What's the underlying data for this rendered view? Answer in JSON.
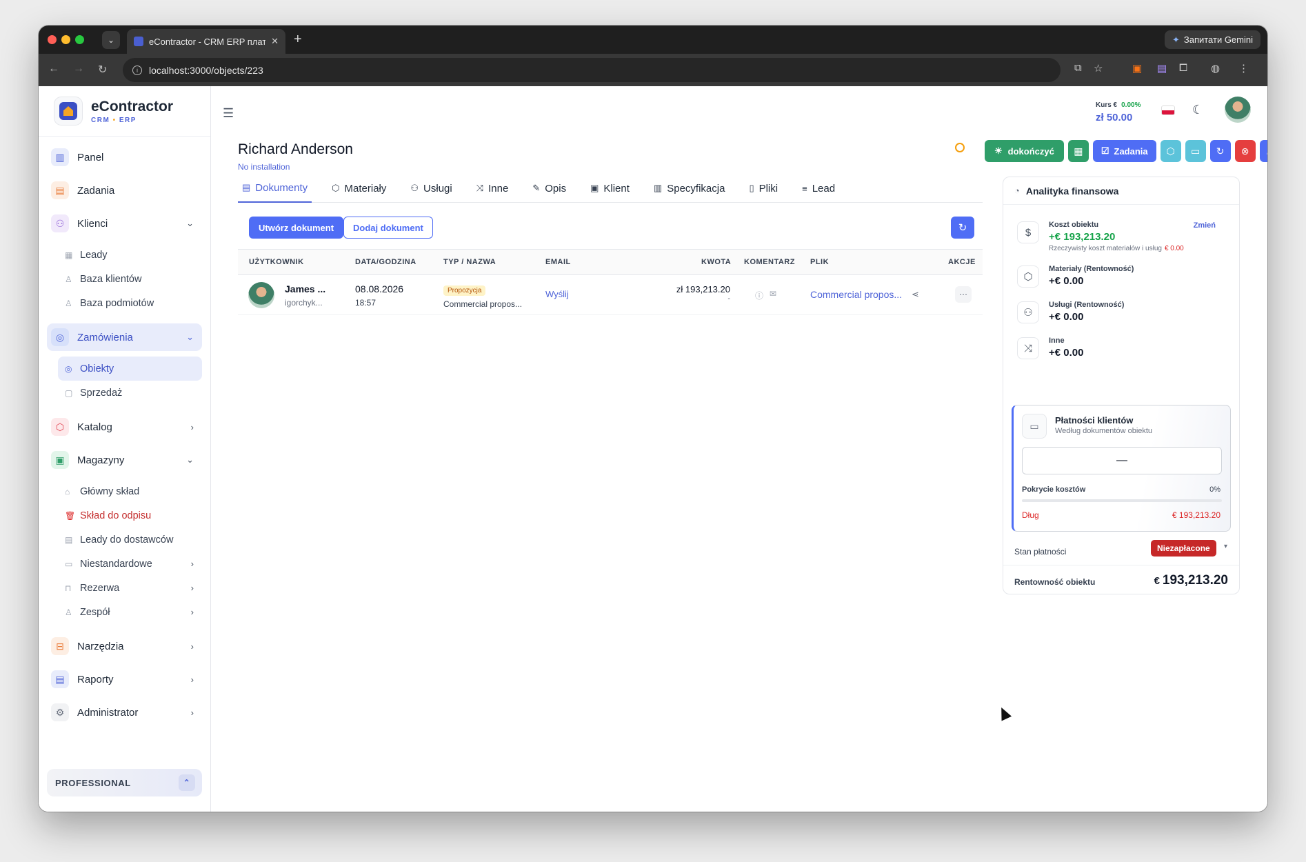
{
  "browser": {
    "tab_title": "eContractor - CRM ERP плат",
    "url": "localhost:3000/objects/223",
    "gemini_label": "Запитати Gemini"
  },
  "app": {
    "name": "eContractor",
    "subtitle_left": "CRM",
    "subtitle_sep": "•",
    "subtitle_right": "ERP"
  },
  "sidebar": {
    "items": [
      {
        "label": "Panel",
        "icon": "chart-bar-icon"
      },
      {
        "label": "Zadania",
        "icon": "clipboard-icon"
      },
      {
        "label": "Klienci",
        "icon": "users-icon"
      },
      {
        "label": "Leady",
        "icon": "list-icon"
      },
      {
        "label": "Baza klientów",
        "icon": "user-icon"
      },
      {
        "label": "Baza podmiotów",
        "icon": "user-icon"
      },
      {
        "label": "Zamówienia",
        "icon": "orders-icon"
      },
      {
        "label": "Obiekty",
        "icon": "object-icon"
      },
      {
        "label": "Sprzedaż",
        "icon": "cart-icon"
      },
      {
        "label": "Katalog",
        "icon": "box-icon"
      },
      {
        "label": "Magazyny",
        "icon": "warehouse-icon"
      },
      {
        "label": "Główny skład",
        "icon": "home-icon"
      },
      {
        "label": "Skład do odpisu",
        "icon": "trash-icon"
      },
      {
        "label": "Leady do dostawców",
        "icon": "list-icon"
      },
      {
        "label": "Niestandardowe",
        "icon": "folder-icon"
      },
      {
        "label": "Rezerwa",
        "icon": "lock-icon"
      },
      {
        "label": "Zespół",
        "icon": "user-icon"
      },
      {
        "label": "Narzędzia",
        "icon": "toolbox-icon"
      },
      {
        "label": "Raporty",
        "icon": "report-icon"
      },
      {
        "label": "Administrator",
        "icon": "gear-icon"
      }
    ],
    "plan": "PROFESSIONAL"
  },
  "header": {
    "kurs_label": "Kurs €",
    "kurs_change": "0.00%",
    "kurs_value": "zł 50.00"
  },
  "object": {
    "title": "Richard Anderson",
    "subtitle": "No installation",
    "actions": {
      "finish": "dokończyć",
      "tasks": "Zadania"
    }
  },
  "tabs": [
    "Dokumenty",
    "Materiały",
    "Usługi",
    "Inne",
    "Opis",
    "Klient",
    "Specyfikacja",
    "Pliki",
    "Lead"
  ],
  "toolbar": {
    "create": "Utwórz dokument",
    "add": "Dodaj dokument"
  },
  "table": {
    "headers": [
      "UŻYTKOWNIK",
      "DATA/GODZINA",
      "TYP / NAZWA",
      "EMAIL",
      "KWOTA",
      "KOMENTARZ",
      "PLIK",
      "AKCJE"
    ],
    "rows": [
      {
        "user_name": "James ...",
        "user_login": "igorchyk...",
        "date": "08.08.2026",
        "time": "18:57",
        "type": "Propozycja",
        "name": "Commercial propos...",
        "email": "Wyślij",
        "amount": "zł 193,213.20",
        "amount_sub": "-",
        "file": "Commercial propos..."
      }
    ]
  },
  "finance": {
    "title": "Analityka finansowa",
    "cost_label": "Koszt obiektu",
    "cost_change": "Zmień",
    "cost_value": "+€ 193,213.20",
    "cost_note": "Rzeczywisty koszt materiałów i usług",
    "cost_note_value": "€ 0.00",
    "materials_label": "Materiały (Rentowność)",
    "materials_value": "+€ 0.00",
    "services_label": "Usługi (Rentowność)",
    "services_value": "+€ 0.00",
    "other_label": "Inne",
    "other_value": "+€ 0.00",
    "payments_title": "Płatności klientów",
    "payments_sub": "Według dokumentów obiektu",
    "payments_value": "—",
    "coverage_label": "Pokrycie kosztów",
    "coverage_pct": "0%",
    "coverage_fraction": 0,
    "debt_label": "Dług",
    "debt_value": "€ 193,213.20",
    "status_label": "Stan płatności",
    "status_value": "Niezapłacone",
    "profit_label": "Rentowność obiektu",
    "profit_currency": "€",
    "profit_value": "193,213.20"
  }
}
